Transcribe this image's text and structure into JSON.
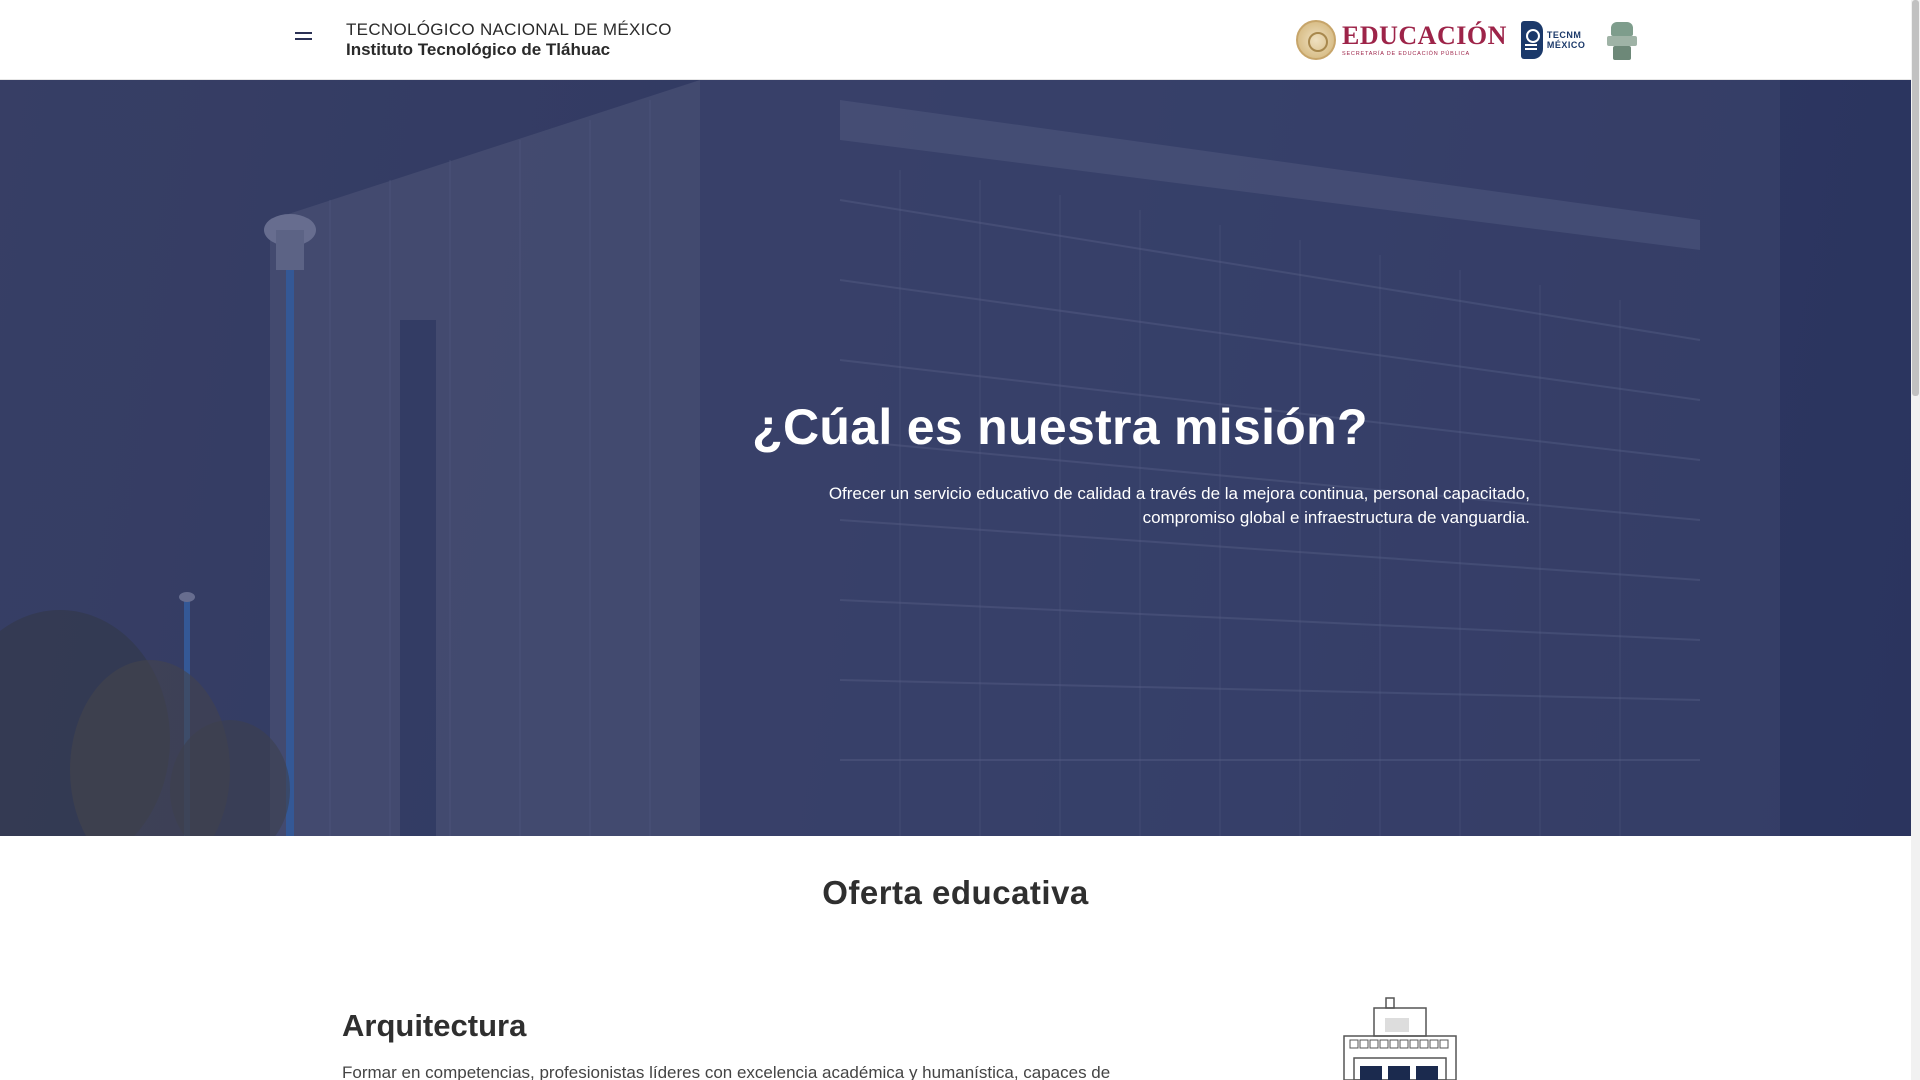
{
  "header": {
    "title_line1": "TECNOLÓGICO NACIONAL DE MÉXICO",
    "title_line2": "Instituto Tecnológico de Tláhuac",
    "logos": {
      "sep_word": "EDUCACIÓN",
      "sep_sub": "SECRETARÍA DE EDUCACIÓN PÚBLICA",
      "tecnm_line1": "TECNM",
      "tecnm_line2": "MÉXICO"
    },
    "menu_icon": "hamburger-menu-icon"
  },
  "hero": {
    "heading": "¿Cúal es nuestra misión?",
    "text": "Ofrecer un servicio educativo de calidad a través de la mejora continua, personal capacitado, compromiso global e infraestructura de vanguardia."
  },
  "offer": {
    "title": "Oferta educativa",
    "career": {
      "name": "Arquitectura",
      "description": "Formar en competencias, profesionistas líderes con excelencia académica y humanística, capaces de"
    }
  },
  "colors": {
    "brand_navy": "#2b3155",
    "sep_maroon": "#9d2449",
    "tecnm_blue": "#1b396a",
    "hero_overlay": "#262e5c"
  }
}
